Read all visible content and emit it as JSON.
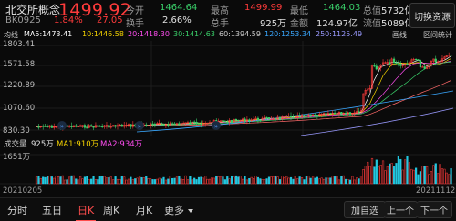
{
  "header": {
    "name": "北交所概念",
    "price": "1499.92",
    "code": "BK0925",
    "change_pct": "1.84%",
    "change": "27.05",
    "stats": [
      {
        "label": "今开",
        "value": "1464.64",
        "tone": "green"
      },
      {
        "label": "最高",
        "value": "1499.99",
        "tone": "red"
      },
      {
        "label": "最低",
        "value": "1464.03",
        "tone": "green"
      },
      {
        "label": "总值",
        "value": "5732亿",
        "tone": "white"
      },
      {
        "label": "换手",
        "value": "2.66%",
        "tone": "white"
      },
      {
        "label": "总手",
        "value": "925万",
        "tone": "white"
      },
      {
        "label": "金额",
        "value": "124.97亿",
        "tone": "white"
      },
      {
        "label": "流值",
        "value": "5089亿",
        "tone": "white"
      }
    ],
    "switch_button": "切换资源"
  },
  "ma_legend": {
    "label": "均线",
    "ma5": "MA5:1473.41",
    "ma10": "10:1446.58",
    "ma20": "20:1418.30",
    "ma30": "30:1414.63",
    "ma60": "60:1394.59",
    "ma120": "120:1253.34",
    "ma250": "250:1125.49",
    "draw_btn": "画线",
    "zone_btn": "区间统计"
  },
  "price_axis": {
    "top": "1803.41",
    "l2": "1571.58",
    "l3": "1220.89",
    "l4": "1070.60",
    "bottom": "830.30"
  },
  "volume": {
    "label": "成交量",
    "value": "925万",
    "ma1": "MA1:910万",
    "ma2": "MA2:934万",
    "axis_top": "1651万",
    "start_date": "20210205",
    "end_date": "20211112"
  },
  "colors": {
    "up": "#ff3b3b",
    "down": "#3ad06a",
    "ma5": "#ffffff",
    "ma10": "#f5d300",
    "ma20": "#ff4df0",
    "ma30": "#3ad06a",
    "ma60": "#ff6a6a",
    "ma120": "#3aa8ff",
    "ma250": "#9a9aff",
    "vol_up": "#ff3b3b",
    "vol_down": "#23c8e0"
  },
  "tabs": [
    {
      "label": "分时",
      "active": false
    },
    {
      "label": "五日",
      "active": false
    },
    {
      "label": "日K",
      "active": true
    },
    {
      "label": "周K",
      "active": false
    },
    {
      "label": "月K",
      "active": false
    },
    {
      "label": "更多",
      "active": false
    }
  ],
  "bottom_buttons": {
    "add": "加自选",
    "prev": "上一个",
    "next": "下一个"
  }
}
